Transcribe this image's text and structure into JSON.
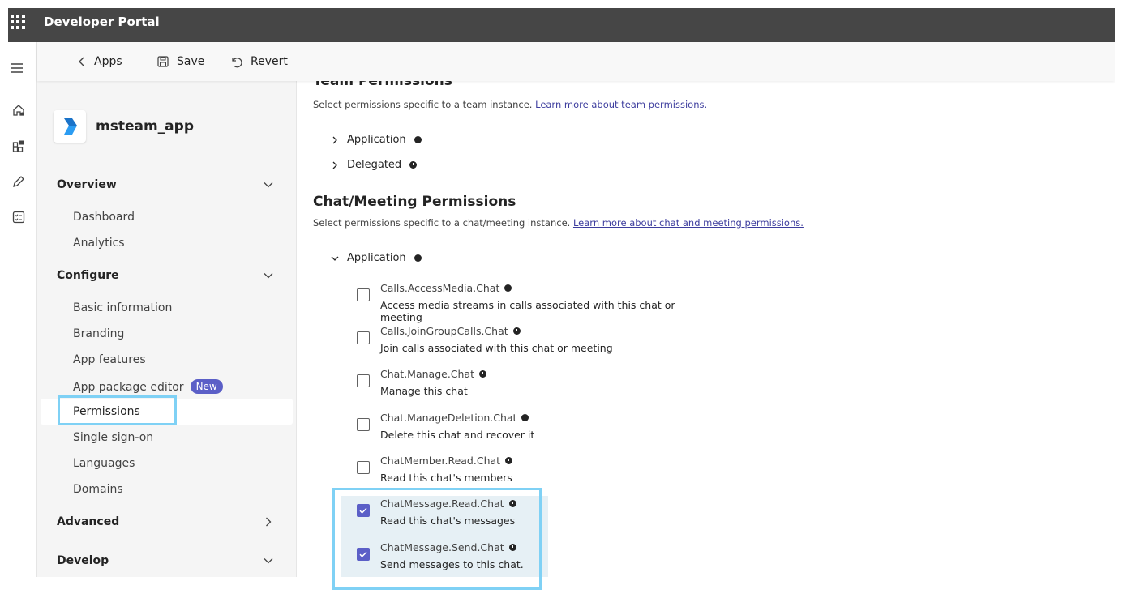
{
  "topbar": {
    "title": "Developer Portal"
  },
  "toolbar": {
    "back_label": "Apps",
    "save_label": "Save",
    "revert_label": "Revert"
  },
  "rail": {
    "icons": [
      "home-icon",
      "apps-icon",
      "edit-icon",
      "checklist-icon"
    ]
  },
  "app": {
    "name": "msteam_app"
  },
  "nav": {
    "overview": {
      "label": "Overview",
      "items": [
        "Dashboard",
        "Analytics"
      ]
    },
    "configure": {
      "label": "Configure",
      "items": [
        "Basic information",
        "Branding",
        "App features",
        "App package editor",
        "Permissions",
        "Single sign-on",
        "Languages",
        "Domains"
      ],
      "new_badge": "New"
    },
    "advanced": {
      "label": "Advanced"
    },
    "develop": {
      "label": "Develop"
    }
  },
  "main": {
    "team_title": "Team Permissions",
    "team_desc": "Select permissions specific to a team instance.",
    "team_link": "Learn more about team permissions.",
    "team_application": "Application",
    "team_delegated": "Delegated",
    "chat_title": "Chat/Meeting Permissions",
    "chat_desc": "Select permissions specific to a chat/meeting instance.",
    "chat_link": "Learn more about chat and meeting permissions.",
    "chat_application": "Application",
    "permissions": [
      {
        "name": "Calls.AccessMedia.Chat",
        "desc": "Access media streams in calls associated with this chat or meeting",
        "checked": false
      },
      {
        "name": "Calls.JoinGroupCalls.Chat",
        "desc": "Join calls associated with this chat or meeting",
        "checked": false
      },
      {
        "name": "Chat.Manage.Chat",
        "desc": "Manage this chat",
        "checked": false
      },
      {
        "name": "Chat.ManageDeletion.Chat",
        "desc": "Delete this chat and recover it",
        "checked": false
      },
      {
        "name": "ChatMember.Read.Chat",
        "desc": "Read this chat's members",
        "checked": false
      },
      {
        "name": "ChatMessage.Read.Chat",
        "desc": "Read this chat's messages",
        "checked": true
      },
      {
        "name": "ChatMessage.Send.Chat",
        "desc": "Send messages to this chat.",
        "checked": true
      }
    ]
  },
  "colors": {
    "topbar": "#464646",
    "accent": "#5b5fc7",
    "highlight": "#7fd1f5"
  }
}
